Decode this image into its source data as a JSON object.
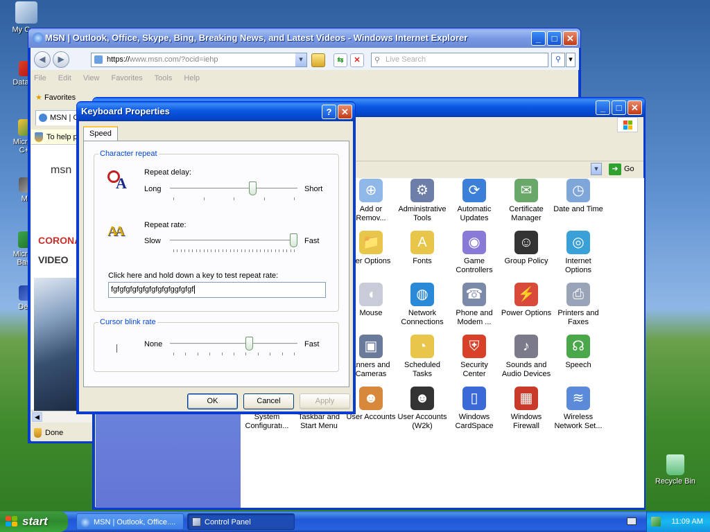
{
  "desktop": {
    "icons": [
      {
        "label": "My Com"
      },
      {
        "label": "DataWa"
      },
      {
        "label": "Microso\nC++"
      },
      {
        "label": "My"
      },
      {
        "label": "Microso\nBasic"
      },
      {
        "label": "Dev-"
      },
      {
        "label": "Recycle Bin"
      }
    ]
  },
  "ie": {
    "title": "MSN | Outlook, Office, Skype, Bing, Breaking News, and Latest Videos - Windows Internet Explorer",
    "url_prefix": "https://",
    "url_host": "www.msn.com",
    "url_path": "/?ocid=iehp",
    "search_placeholder": "Live Search",
    "menu": [
      "File",
      "Edit",
      "View",
      "Favorites",
      "Tools",
      "Help"
    ],
    "favorites_label": "Favorites",
    "tab_label": "MSN | C",
    "infobar_text": "To help p",
    "msn_logo": "msn",
    "headline_red": "CORONA",
    "headline_video": "VIDEO",
    "status": "Done"
  },
  "control_panel": {
    "go_label": "Go",
    "items": [
      {
        "label": "Add or\nRemov..."
      },
      {
        "label": "Administrative\nTools"
      },
      {
        "label": "Automatic\nUpdates"
      },
      {
        "label": "Certificate\nManager"
      },
      {
        "label": "Date and Time"
      },
      {
        "label": "der Options"
      },
      {
        "label": "Fonts"
      },
      {
        "label": "Game\nControllers"
      },
      {
        "label": "Group Policy"
      },
      {
        "label": "Internet\nOptions"
      },
      {
        "label": "Mouse"
      },
      {
        "label": "Network\nConnections"
      },
      {
        "label": "Phone and\nModem ..."
      },
      {
        "label": "Power Options"
      },
      {
        "label": "Printers and\nFaxes"
      },
      {
        "label": "anners and\nCameras"
      },
      {
        "label": "Scheduled\nTasks"
      },
      {
        "label": "Security\nCenter"
      },
      {
        "label": "Sounds and\nAudio Devices"
      },
      {
        "label": "Speech"
      },
      {
        "label": "System\nConfiguratı..."
      },
      {
        "label": "Taskbar and\nStart Menu"
      },
      {
        "label": "User Accounts"
      },
      {
        "label": "User Accounts\n(W2k)"
      },
      {
        "label": "Windows\nCardSpace"
      },
      {
        "label": "Windows\nFirewall"
      },
      {
        "label": "Wireless\nNetwork Set..."
      }
    ]
  },
  "dialog": {
    "title": "Keyboard Properties",
    "tab": "Speed",
    "group_char_repeat": "Character repeat",
    "repeat_delay_label": "Repeat delay:",
    "repeat_delay_min": "Long",
    "repeat_delay_max": "Short",
    "repeat_delay_value": 0.66,
    "repeat_rate_label": "Repeat rate:",
    "repeat_rate_min": "Slow",
    "repeat_rate_max": "Fast",
    "repeat_rate_value": 1.0,
    "test_label": "Click here and hold down a key to test repeat rate:",
    "test_value": "fgfgfgfgfgfgfgfgfgfggfgfgf",
    "group_blink": "Cursor blink rate",
    "blink_min": "None",
    "blink_max": "Fast",
    "blink_value": 0.63,
    "ok": "OK",
    "cancel": "Cancel",
    "apply": "Apply"
  },
  "taskbar": {
    "start": "start",
    "tasks": [
      "MSN | Outlook, Office....",
      "Control Panel"
    ],
    "clock": "11:09 AM"
  }
}
